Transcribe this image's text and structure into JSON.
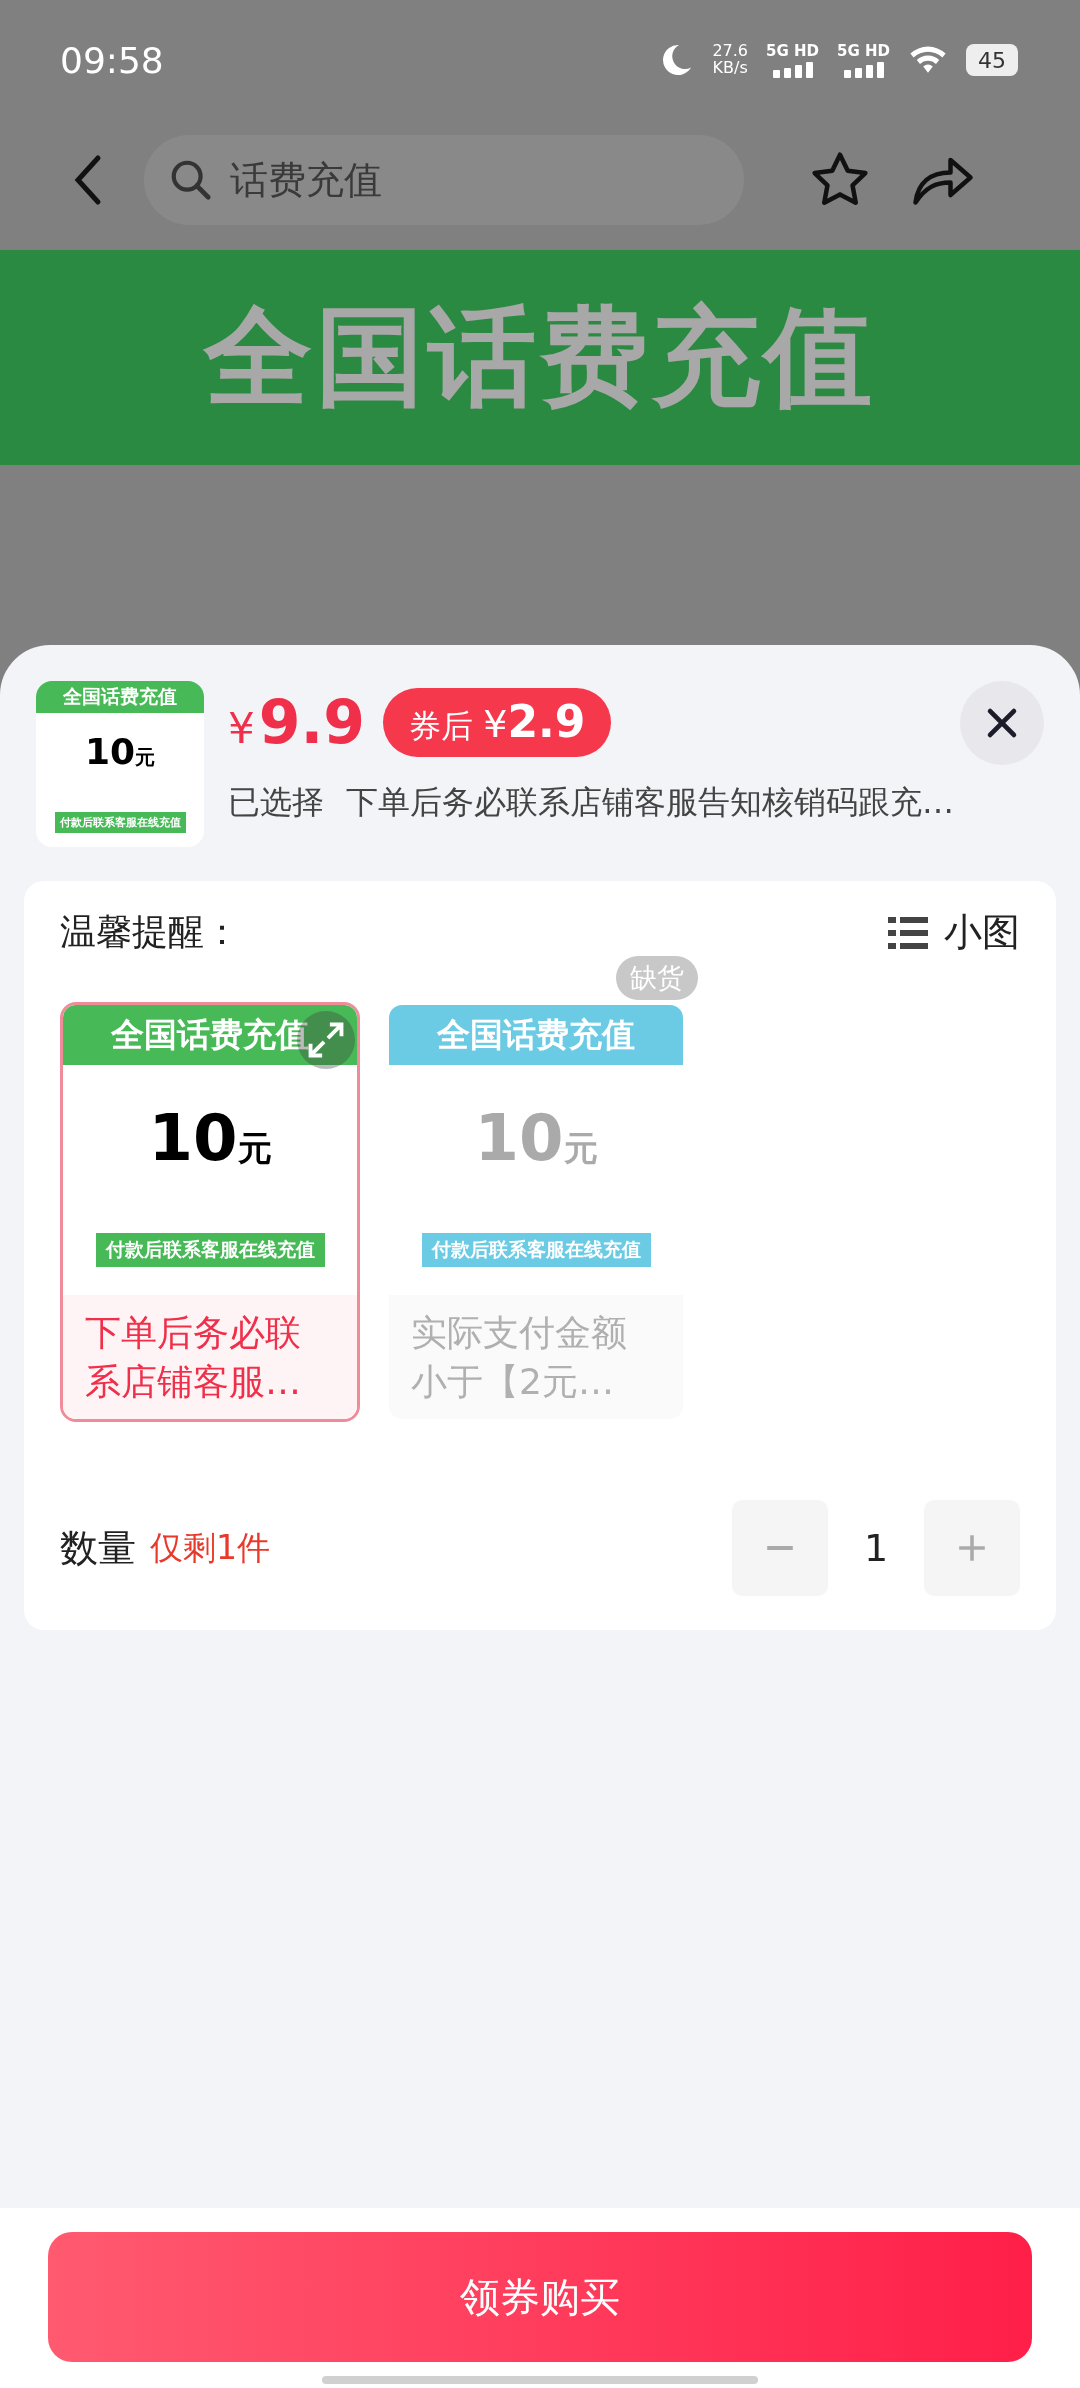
{
  "status_bar": {
    "time": "09:58",
    "net_speed": "27.6",
    "net_unit": "KB/s",
    "sim_labels": [
      "5G HD",
      "5G HD"
    ],
    "battery": "45"
  },
  "search": {
    "placeholder": "话费充值"
  },
  "banner": {
    "title": "全国话费充值"
  },
  "header": {
    "thumbnail": {
      "title": "全国话费充值",
      "amount": "10",
      "unit": "元",
      "note": "付款后联系客服在线充值"
    },
    "price": {
      "currency": "¥",
      "value": "9.9"
    },
    "coupon": {
      "label": "券后",
      "currency": "¥",
      "value": "2.9"
    },
    "selected_label": "已选择",
    "selected_value": "下单后务必联系店铺客服告知核销码跟充…"
  },
  "reminder": {
    "title": "温馨提醒：",
    "view_toggle": "小图"
  },
  "options": [
    {
      "title": "全国话费充值",
      "amount": "10",
      "unit": "元",
      "note": "付款后联系客服在线充值",
      "caption": "下单后务必联系店铺客服…",
      "selected": true,
      "out_of_stock": false
    },
    {
      "title": "全国话费充值",
      "amount": "10",
      "unit": "元",
      "note": "付款后联系客服在线充值",
      "caption": "实际支付金额小于【2元…",
      "selected": false,
      "out_of_stock": true,
      "badge": "缺货"
    }
  ],
  "quantity": {
    "label": "数量",
    "stock_note": "仅剩1件",
    "value": "1"
  },
  "buy_button": "领券购买"
}
